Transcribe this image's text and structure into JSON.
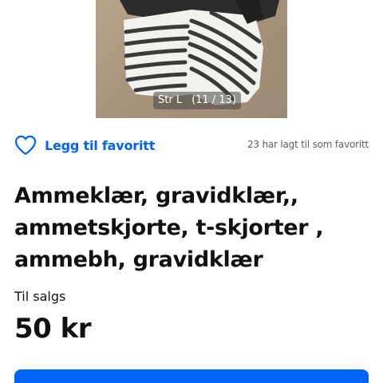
{
  "gallery": {
    "caption": "Str L",
    "counter": "(11 / 13)"
  },
  "favorite": {
    "label": "Legg til favoritt",
    "count_text": "23 har lagt til som favoritt",
    "icon": "heart-outline-icon"
  },
  "listing": {
    "title": "Ammeklær, gravidklær,, ammetskjorte, t-skjorter , ammebh, gravidklær",
    "status": "Til salgs",
    "price": "50 kr"
  },
  "colors": {
    "accent": "#0063fb",
    "text": "#111111",
    "muted": "#5f5f5f"
  }
}
